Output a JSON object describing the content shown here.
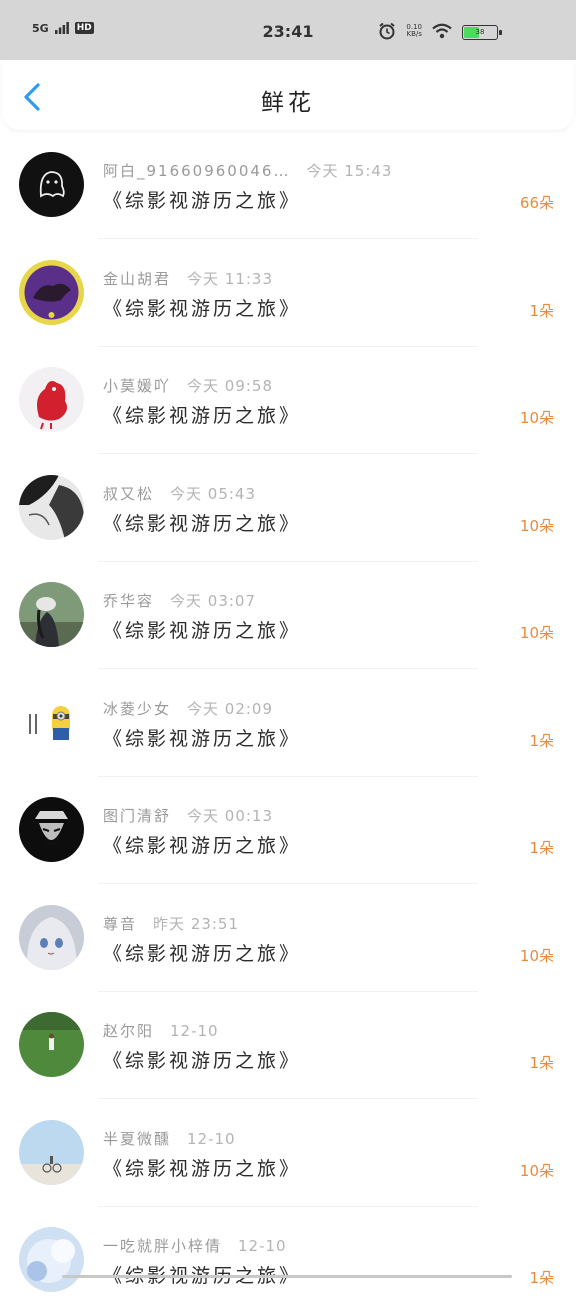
{
  "status_bar": {
    "network": "5G",
    "hd": "HD",
    "time": "23:41",
    "net_speed": "0.10",
    "net_unit": "KB/s",
    "battery": "38"
  },
  "header": {
    "title": "鲜花"
  },
  "items": [
    {
      "name": "阿白_91660960046…",
      "time": "今天 15:43",
      "book": "《综影视游历之旅》",
      "count": "66朵"
    },
    {
      "name": "金山胡君",
      "time": "今天 11:33",
      "book": "《综影视游历之旅》",
      "count": "1朵"
    },
    {
      "name": "小莫媛吖",
      "time": "今天 09:58",
      "book": "《综影视游历之旅》",
      "count": "10朵"
    },
    {
      "name": "叔又松",
      "time": "今天 05:43",
      "book": "《综影视游历之旅》",
      "count": "10朵"
    },
    {
      "name": "乔华容",
      "time": "今天 03:07",
      "book": "《综影视游历之旅》",
      "count": "10朵"
    },
    {
      "name": "冰菱少女",
      "time": "今天 02:09",
      "book": "《综影视游历之旅》",
      "count": "1朵"
    },
    {
      "name": "图门清舒",
      "time": "今天 00:13",
      "book": "《综影视游历之旅》",
      "count": "1朵"
    },
    {
      "name": "尊音",
      "time": "昨天 23:51",
      "book": "《综影视游历之旅》",
      "count": "10朵"
    },
    {
      "name": "赵尔阳",
      "time": "12-10",
      "book": "《综影视游历之旅》",
      "count": "1朵"
    },
    {
      "name": "半夏微醺",
      "time": "12-10",
      "book": "《综影视游历之旅》",
      "count": "10朵"
    },
    {
      "name": "一吃就胖小梓倩",
      "time": "12-10",
      "book": "《综影视游历之旅》",
      "count": "1朵"
    }
  ],
  "colors": {
    "accent": "#2f9bf0",
    "count": "#e98a3c"
  }
}
